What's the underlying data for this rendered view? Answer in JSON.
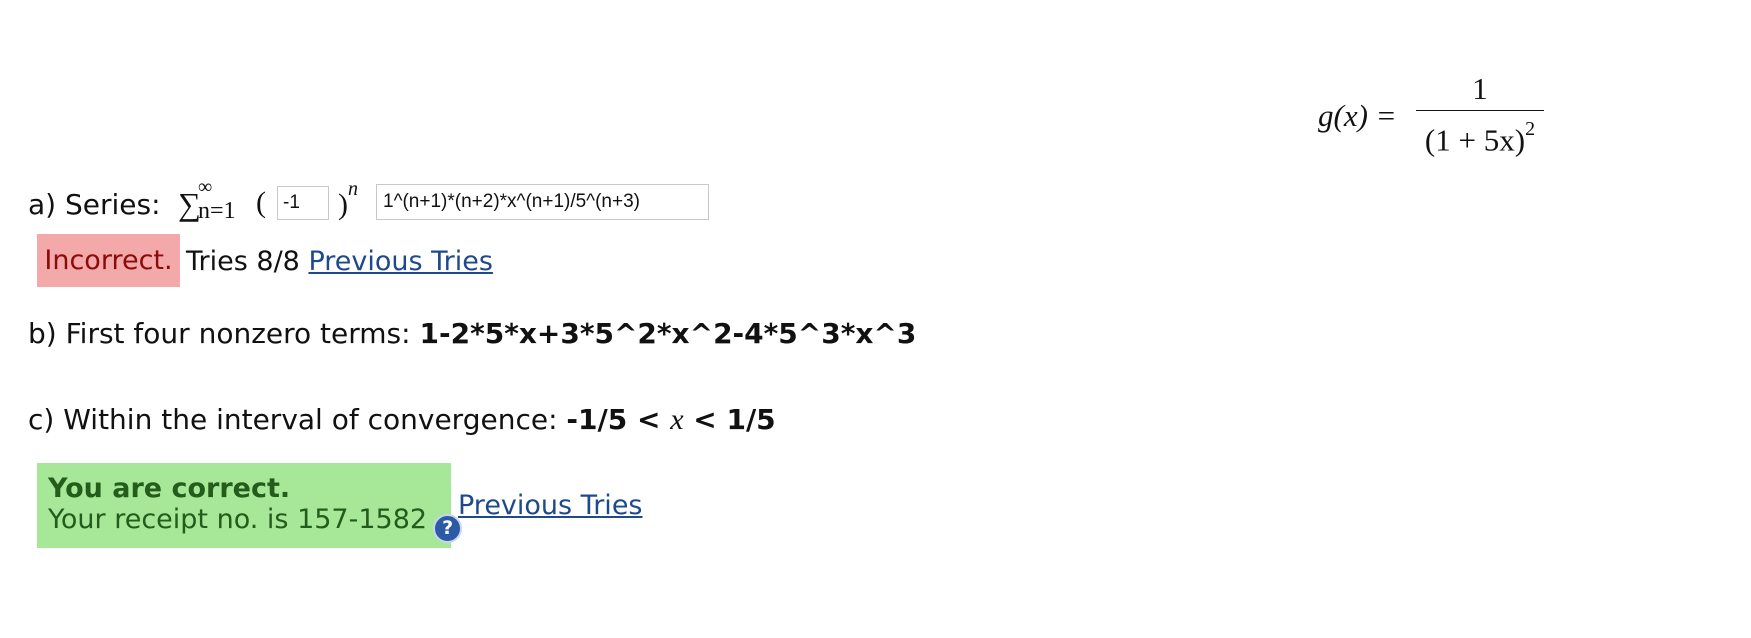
{
  "formula": {
    "lhs": "g(x) =",
    "numerator": "1",
    "denominator": "(1 + 5x)",
    "denominator_exponent": "2"
  },
  "part_a": {
    "label": "a) Series:",
    "sigma_symbol": "∑",
    "sigma_upper": "∞",
    "sigma_lower": "n=1",
    "paren_open": "(",
    "coefficient_value": "-1",
    "paren_close": ")",
    "exponent": "n",
    "term_value": "1^(n+1)*(n+2)*x^(n+1)/5^(n+3)",
    "status": "Incorrect.",
    "tries_text": "Tries 8/8",
    "previous_tries_link": "Previous Tries"
  },
  "part_b": {
    "label": "b) First four nonzero terms:",
    "answer": "1-2*5*x+3*5^2*x^2-4*5^3*x^3"
  },
  "part_c": {
    "label": "c) Within the interval of convergence:",
    "answer_left": "-1/5 <",
    "answer_var": "x",
    "answer_right": "< 1/5",
    "status_title": "You are correct.",
    "receipt_text": "Your receipt no. is 157-1582",
    "help_icon": "?",
    "previous_tries_link": "Previous Tries"
  },
  "colors": {
    "incorrect_bg": "#f3a9a9",
    "incorrect_text": "#8b0a0a",
    "correct_bg": "#a6e898",
    "correct_text": "#245c1b",
    "link": "#1e4a8c"
  },
  "icons": {
    "help": "help-circle-icon"
  }
}
